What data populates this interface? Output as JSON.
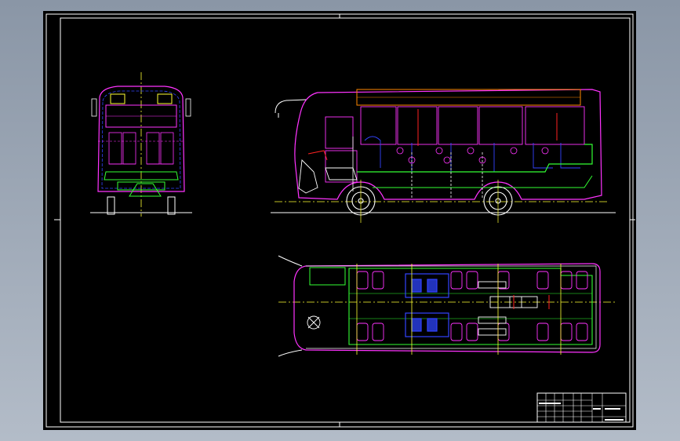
{
  "drawing": {
    "background": "#000000",
    "colors": {
      "frame": "#ffffff",
      "magenta": "#ff33ff",
      "green": "#33ff33",
      "blue": "#3344ff",
      "yellow": "#ffff33",
      "red": "#ff2222",
      "orange": "#ff8800",
      "white": "#ffffff"
    },
    "views": [
      "front-view",
      "side-view",
      "top-view"
    ],
    "title_block": {
      "cells": [
        "",
        "",
        "",
        "",
        "",
        "",
        "",
        "",
        "",
        "",
        "",
        ""
      ]
    }
  }
}
